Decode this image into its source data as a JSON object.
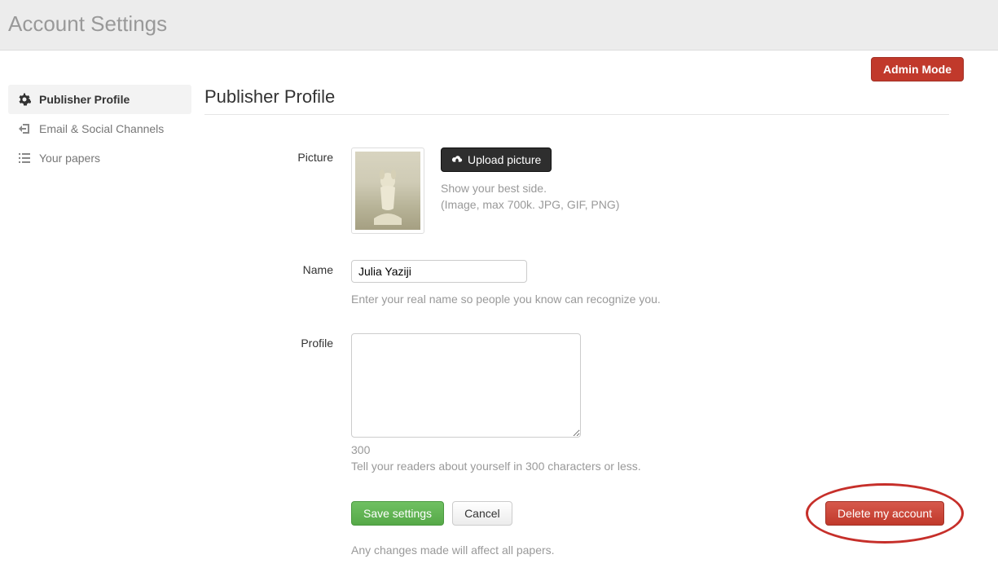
{
  "header": {
    "title": "Account Settings"
  },
  "admin_mode_label": "Admin Mode",
  "sidebar": {
    "items": [
      {
        "label": "Publisher Profile",
        "icon": "gear-icon",
        "active": true
      },
      {
        "label": "Email & Social Channels",
        "icon": "login-icon",
        "active": false
      },
      {
        "label": "Your papers",
        "icon": "list-icon",
        "active": false
      }
    ]
  },
  "main": {
    "heading": "Publisher Profile",
    "picture": {
      "label": "Picture",
      "upload_button": "Upload picture",
      "help1": "Show your best side.",
      "help2": "(Image, max 700k. JPG, GIF, PNG)"
    },
    "name": {
      "label": "Name",
      "value": "Julia Yaziji",
      "help": "Enter your real name so people you know can recognize you."
    },
    "profile": {
      "label": "Profile",
      "value": "",
      "counter": "300",
      "help": "Tell your readers about yourself in 300 characters or less."
    },
    "actions": {
      "save": "Save settings",
      "cancel": "Cancel",
      "delete": "Delete my account",
      "note": "Any changes made will affect all papers."
    }
  }
}
